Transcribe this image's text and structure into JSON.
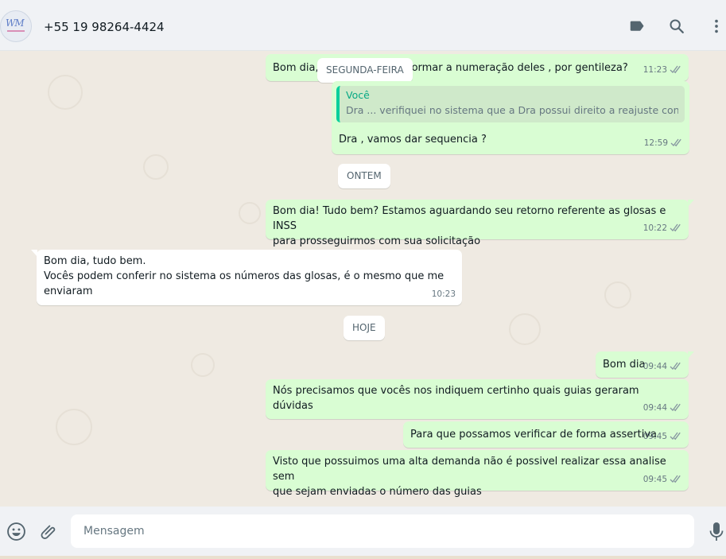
{
  "header": {
    "contact_name": "+55 19 98264-4424",
    "icons": [
      "label-icon",
      "search-icon",
      "menu-icon"
    ]
  },
  "separators": {
    "segunda": "SEGUNDA-FEIRA",
    "ontem": "ONTEM",
    "hoje": "HOJE"
  },
  "messages": [
    {
      "direction": "out",
      "text": "Bom dia, ",
      "text_after": "formar a numeração deles , por gentileza?",
      "time": "11:23",
      "status": "read"
    },
    {
      "direction": "out",
      "quote_author": "Você",
      "quote_text": "Dra ... verifiquei no sistema que a Dra possui direito a reajuste contratual",
      "text": "Dra , vamos dar sequencia ?",
      "time": "12:59",
      "status": "read"
    },
    {
      "direction": "out",
      "line1": "Bom dia! Tudo bem? Estamos aguardando seu retorno referente as glosas e INSS",
      "line2": "para prosseguirmos com sua solicitação",
      "time": "10:22",
      "status": "read"
    },
    {
      "direction": "in",
      "line1": "Bom dia, tudo bem.",
      "line2": "Vocês podem conferir no sistema os números das glosas, é o mesmo que me",
      "line3": "enviaram",
      "time": "10:23"
    },
    {
      "direction": "out",
      "text": "Bom dia",
      "time": "09:44",
      "status": "read"
    },
    {
      "direction": "out",
      "text": "Nós precisamos que vocês nos indiquem certinho quais guias geraram dúvidas",
      "time": "09:44",
      "status": "read"
    },
    {
      "direction": "out",
      "text": "Para que possamos verificar de forma assertiva",
      "time": "09:45",
      "status": "read"
    },
    {
      "direction": "out",
      "line1": "Visto que possuimos uma alta demanda não é possivel realizar essa analise sem",
      "line2": "que sejam enviadas o número das guias",
      "time": "09:45",
      "status": "read"
    }
  ],
  "composer": {
    "placeholder": "Mensagem",
    "icons": [
      "emoji-icon",
      "attach-icon",
      "microphone-icon"
    ]
  },
  "colors": {
    "outgoing_bubble": "#d9fdd3",
    "incoming_bubble": "#ffffff",
    "chat_background": "#efeae2",
    "header_background": "#f0f2f5",
    "read_tick": "#8696a0",
    "quote_accent": "#06cf9c"
  }
}
